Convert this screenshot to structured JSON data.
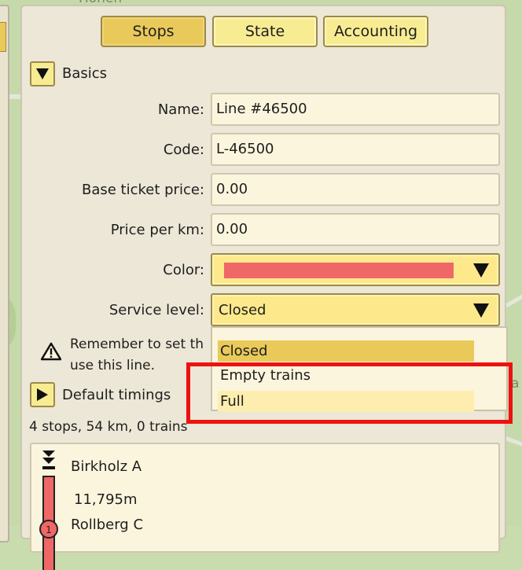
{
  "map": {
    "top_label": "Höhen",
    "right_label": "a"
  },
  "tabs": [
    {
      "label": "Stops",
      "active": true
    },
    {
      "label": "State",
      "active": false
    },
    {
      "label": "Accounting",
      "active": false
    }
  ],
  "basics": {
    "label": "Basics",
    "fields": {
      "name": {
        "label": "Name:",
        "value": "Line #46500"
      },
      "code": {
        "label": "Code:",
        "value": "L-46500"
      },
      "base_price": {
        "label": "Base ticket price:",
        "value": "0.00"
      },
      "price_km": {
        "label": "Price per km:",
        "value": "0.00"
      },
      "color": {
        "label": "Color:",
        "value": "#ef6767"
      },
      "service": {
        "label": "Service level:",
        "value": "Closed"
      }
    }
  },
  "service_options": [
    "Closed",
    "Empty trains",
    "Full"
  ],
  "warning": {
    "line1": "Remember to set th",
    "line2": "use this line."
  },
  "default_timings": {
    "label": "Default timings"
  },
  "summary": "4 stops, 54 km, 0 trains",
  "stops": {
    "first": "Birkholz A",
    "distance": "11,795m",
    "second": "Rollberg C",
    "number": "1"
  },
  "colors": {
    "line": "#ef6767",
    "accent": "#e9c95a",
    "highlight": "#ee1111"
  }
}
